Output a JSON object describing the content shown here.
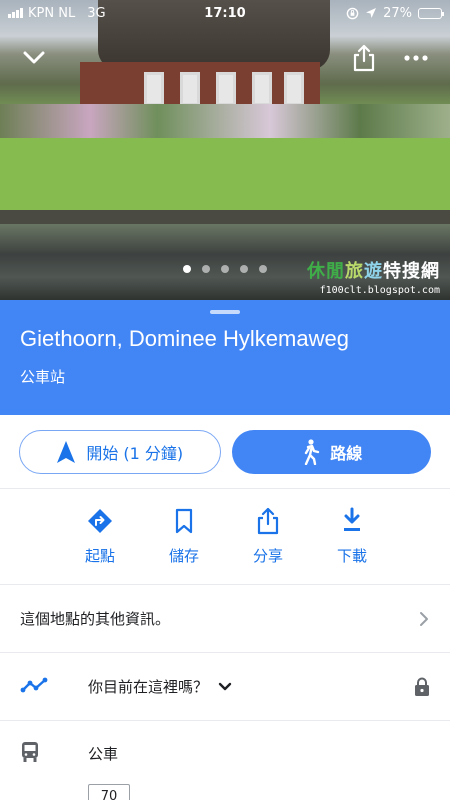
{
  "status_bar": {
    "carrier": "KPN NL",
    "network": "3G",
    "time": "17:10",
    "battery": "27%",
    "battery_level": 0.27
  },
  "hero": {
    "photo_count": 5,
    "active_index": 0,
    "watermark": {
      "title_part1": "休閒",
      "title_part2": "旅",
      "title_part3": "遊",
      "title_part4": "特搜網",
      "url": "f100clt.blogspot.com"
    }
  },
  "place": {
    "name": "Giethoorn, Dominee Hylkemaweg",
    "type": "公車站"
  },
  "actions": {
    "start_label": "開始 (1 分鐘)",
    "directions_label": "路線"
  },
  "quick_actions": [
    {
      "label": "起點",
      "icon": "directions-icon"
    },
    {
      "label": "儲存",
      "icon": "bookmark-icon"
    },
    {
      "label": "分享",
      "icon": "share-icon"
    },
    {
      "label": "下載",
      "icon": "download-icon"
    }
  ],
  "more_info": {
    "label": "這個地點的其他資訊。"
  },
  "here_prompt": {
    "label": "你目前在這裡嗎？"
  },
  "transit": {
    "label": "公車",
    "route": "70"
  },
  "colors": {
    "primary": "#4285f4",
    "link": "#1a73e8",
    "divider": "#e8eaed"
  }
}
